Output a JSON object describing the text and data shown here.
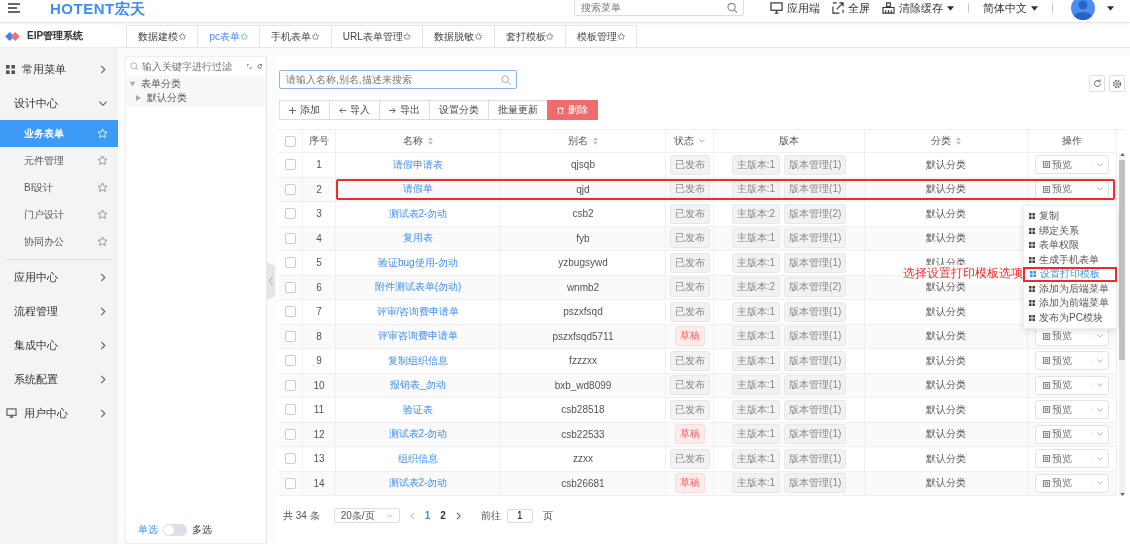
{
  "header": {
    "logo": "HOTENT宏天",
    "search": {
      "placeholder": "搜索菜单"
    },
    "actions": [
      {
        "label": "应用端",
        "caret": false
      },
      {
        "label": "全屏",
        "caret": false
      },
      {
        "label": "清除缓存",
        "caret": true
      },
      {
        "label": "简体中文",
        "caret": true
      }
    ]
  },
  "sidebar": {
    "title": "EIP管理系统",
    "items": [
      {
        "label": "常用菜单",
        "expanded": false
      },
      {
        "label": "设计中心",
        "expanded": true,
        "children": [
          {
            "label": "业务表单",
            "selected": true
          },
          {
            "label": "元件管理",
            "selected": false
          },
          {
            "label": "BI设计",
            "selected": false
          },
          {
            "label": "门户设计",
            "selected": false
          },
          {
            "label": "协同办公",
            "selected": false
          }
        ]
      },
      {
        "label": "应用中心",
        "expanded": false
      },
      {
        "label": "流程管理",
        "expanded": false
      },
      {
        "label": "集成中心",
        "expanded": false
      },
      {
        "label": "系统配置",
        "expanded": false
      },
      {
        "label": "用户中心",
        "expanded": false
      }
    ]
  },
  "tabs": [
    {
      "label": "数据建模✩",
      "selected": false
    },
    {
      "label": "pc表单✩",
      "selected": true
    },
    {
      "label": "手机表单✩",
      "selected": false
    },
    {
      "label": "URL表单管理✩",
      "selected": false
    },
    {
      "label": "数据脱敏✩",
      "selected": false
    },
    {
      "label": "套打模板✩",
      "selected": false
    },
    {
      "label": "模板管理✩",
      "selected": false
    }
  ],
  "tree": {
    "placeholder": "输入关键字进行过滤",
    "nodes": [
      {
        "label": "表单分类",
        "expanded": true,
        "children": [
          {
            "label": "默认分类",
            "expanded": false
          }
        ]
      }
    ],
    "mode": {
      "left": "单选",
      "right": "多选",
      "on": false
    }
  },
  "search": {
    "placeholder": "请输入名称,别名,描述来搜索"
  },
  "toolbar": [
    {
      "label": "添加",
      "kind": "plain"
    },
    {
      "label": "导入",
      "kind": "plain"
    },
    {
      "label": "导出",
      "kind": "plain"
    },
    {
      "label": "设置分类",
      "kind": "plain"
    },
    {
      "label": "批量更新",
      "kind": "plain"
    },
    {
      "label": "删除",
      "kind": "danger"
    }
  ],
  "table": {
    "select_all": false,
    "columns": [
      "序号",
      "名称",
      "别名",
      "状态",
      "版本",
      "分类",
      "操作"
    ],
    "rows": [
      {
        "index": "1",
        "name": "请假申请表",
        "alias": "qjsqb",
        "status": "已发布",
        "draft": false,
        "main_version": "主版本:1",
        "versions": "版本管理(1)",
        "category": "默认分类",
        "action": "预览",
        "outlined": false
      },
      {
        "index": "2",
        "name": "请假单",
        "alias": "qjd",
        "status": "已发布",
        "draft": false,
        "main_version": "主版本:1",
        "versions": "版本管理(1)",
        "category": "默认分类",
        "action": "预览",
        "outlined": true
      },
      {
        "index": "3",
        "name": "测试表2-勿动",
        "alias": "csb2",
        "status": "已发布",
        "draft": false,
        "main_version": "主版本:2",
        "versions": "版本管理(2)",
        "category": "默认分类",
        "outlined": false
      },
      {
        "index": "4",
        "name": "复用表",
        "alias": "fyb",
        "status": "已发布",
        "draft": false,
        "main_version": "主版本:1",
        "versions": "版本管理(1)",
        "category": "默认分类",
        "outlined": false
      },
      {
        "index": "5",
        "name": "验证bug使用-勿动",
        "alias": "yzbugsywd",
        "status": "已发布",
        "draft": false,
        "main_version": "主版本:1",
        "versions": "版本管理(1)",
        "category": "默认分类",
        "outlined": false
      },
      {
        "index": "6",
        "name": "附件测试表单(勿动)",
        "alias": "wnmb2",
        "status": "已发布",
        "draft": false,
        "main_version": "主版本:2",
        "versions": "版本管理(2)",
        "category": "默认分类",
        "outlined": false
      },
      {
        "index": "7",
        "name": "评审/咨询费申请单",
        "alias": "pszxfsqd",
        "status": "已发布",
        "draft": false,
        "main_version": "主版本:1",
        "versions": "版本管理(1)",
        "category": "默认分类",
        "outlined": false
      },
      {
        "index": "8",
        "name": "评审咨询费申请单",
        "alias": "pszxfsqd5711",
        "status": "草稿",
        "draft": true,
        "main_version": "主版本:1",
        "versions": "版本管理(1)",
        "category": "默认分类",
        "action": "预览",
        "outlined": false
      },
      {
        "index": "9",
        "name": "复制组织信息",
        "alias": "fzzzxx",
        "status": "已发布",
        "draft": false,
        "main_version": "主版本:1",
        "versions": "版本管理(1)",
        "category": "默认分类",
        "action": "预览",
        "outlined": false
      },
      {
        "index": "10",
        "name": "报销表_勿动",
        "alias": "bxb_wd8099",
        "status": "已发布",
        "draft": false,
        "main_version": "主版本:1",
        "versions": "版本管理(1)",
        "category": "默认分类",
        "action": "预览",
        "outlined": false
      },
      {
        "index": "11",
        "name": "验证表",
        "alias": "csb28518",
        "status": "已发布",
        "draft": false,
        "main_version": "主版本:1",
        "versions": "版本管理(1)",
        "category": "默认分类",
        "action": "预览",
        "outlined": false
      },
      {
        "index": "12",
        "name": "测试表2-勿动",
        "alias": "csb22533",
        "status": "草稿",
        "draft": true,
        "main_version": "主版本:1",
        "versions": "版本管理(1)",
        "category": "默认分类",
        "action": "预览",
        "outlined": false
      },
      {
        "index": "13",
        "name": "组织信息",
        "alias": "zzxx",
        "status": "已发布",
        "draft": false,
        "main_version": "主版本:1",
        "versions": "版本管理(1)",
        "category": "默认分类",
        "action": "预览",
        "outlined": false
      },
      {
        "index": "14",
        "name": "测试表2-勿动",
        "alias": "csb26681",
        "status": "草稿",
        "draft": true,
        "main_version": "主版本:1",
        "versions": "版本管理(1)",
        "category": "默认分类",
        "action": "预览",
        "outlined": false
      }
    ]
  },
  "menu": {
    "items": [
      {
        "label": "复制",
        "selected": false
      },
      {
        "label": "绑定关系",
        "selected": false
      },
      {
        "label": "表单权限",
        "selected": false
      },
      {
        "label": "生成手机表单",
        "selected": false
      },
      {
        "label": "设置打印模板",
        "selected": true
      },
      {
        "label": "添加为后端菜单",
        "selected": false
      },
      {
        "label": "添加为前端菜单",
        "selected": false
      },
      {
        "label": "发布为PC模块",
        "selected": false
      }
    ],
    "annotation": "选择设置打印模板选项"
  },
  "pagination": {
    "total": "共 34 条",
    "page_size": "20条/页",
    "pages": [
      {
        "label": "1",
        "selected": true
      },
      {
        "label": "2",
        "selected": false
      }
    ],
    "goto": "前往",
    "goto_value": "1",
    "suffix": "页"
  }
}
